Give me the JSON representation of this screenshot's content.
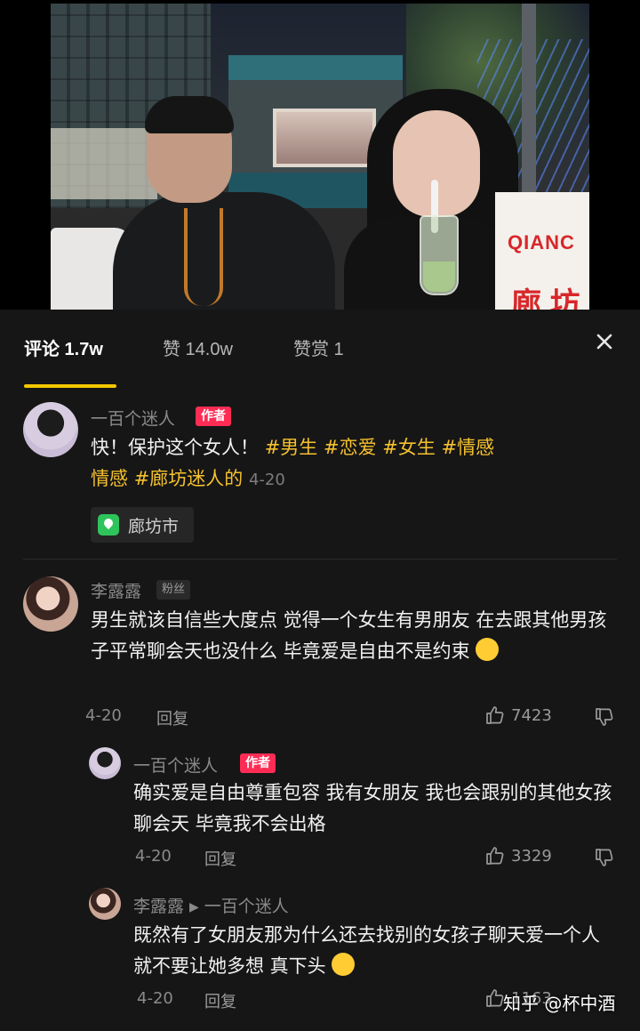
{
  "tabs": {
    "comments": "评论 1.7w",
    "likes": "赞 14.0w",
    "tips": "赞赏 1"
  },
  "post": {
    "author": "一百个迷人",
    "author_badge": "作者",
    "text_prefix": "快！保护这个女人！ ",
    "hashtags": [
      "#男生",
      "#恋爱",
      "#女生",
      "#情感",
      "#廊坊迷人的"
    ],
    "line2_lead": "情感",
    "time": "4-20",
    "location": "廊坊市",
    "location_icon": "location-pin-icon"
  },
  "comment": {
    "author": "李露露",
    "badge": "粉丝",
    "text": "男生就该自信些大度点 觉得一个女生有男朋友 在去跟其他男孩子平常聊会天也没什么 毕竟爱是自由不是约束",
    "emoji": "grinning-sweat-emoji",
    "time": "4-20",
    "reply_label": "回复",
    "likes": "7423"
  },
  "reply1": {
    "author": "一百个迷人",
    "badge": "作者",
    "text": "确实爱是自由尊重包容 我有女朋友 我也会跟别的其他女孩聊会天 毕竟我不会出格",
    "time": "4-20",
    "reply_label": "回复",
    "likes": "3329"
  },
  "reply2": {
    "author": "李露露",
    "reply_to": "一百个迷人",
    "text": "既然有了女朋友那为什么还去找别的女孩子聊天爱一个人就不要让她多想 真下头",
    "emoji": "facepalm-emoji",
    "time": "4-20",
    "reply_label": "回复",
    "likes": "1163"
  },
  "video": {
    "bag_brand": "QIANC",
    "bag_cn": "廊 坊"
  },
  "watermark": "知乎 @杯中酒",
  "colors": {
    "accent": "#f5c700",
    "hashtag": "#f5c12e",
    "author_badge": "#fe2c55",
    "background": "#161616"
  }
}
